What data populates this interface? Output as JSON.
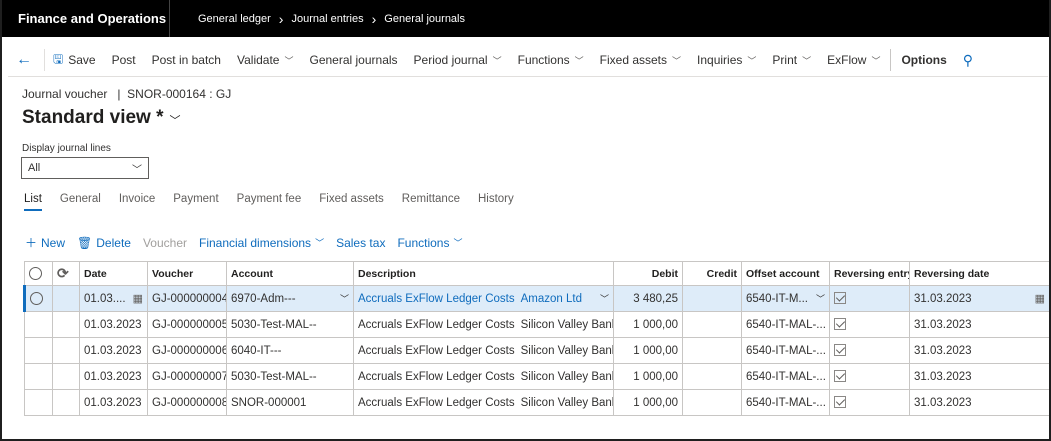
{
  "app_title": "Finance and Operations",
  "breadcrumbs": [
    "General ledger",
    "Journal entries",
    "General journals"
  ],
  "action_pane": {
    "save": "Save",
    "post": "Post",
    "post_in_batch": "Post in batch",
    "validate": "Validate",
    "general_journals": "General journals",
    "period_journal": "Period journal",
    "functions": "Functions",
    "fixed_assets": "Fixed assets",
    "inquiries": "Inquiries",
    "print": "Print",
    "exflow": "ExFlow",
    "options": "Options"
  },
  "header": {
    "caption": "Journal voucher   |  SNOR-000164 : GJ",
    "view_name": "Standard view *",
    "display_lines_label": "Display journal lines",
    "display_lines_value": "All"
  },
  "tabs": [
    "List",
    "General",
    "Invoice",
    "Payment",
    "Payment fee",
    "Fixed assets",
    "Remittance",
    "History"
  ],
  "grid_toolbar": {
    "new": "New",
    "delete": "Delete",
    "voucher": "Voucher",
    "financial_dimensions": "Financial dimensions",
    "sales_tax": "Sales tax",
    "functions": "Functions"
  },
  "columns": {
    "date": "Date",
    "voucher": "Voucher",
    "account": "Account",
    "description": "Description",
    "debit": "Debit",
    "credit": "Credit",
    "offset_account": "Offset account",
    "reversing_entry": "Reversing entry",
    "reversing_date": "Reversing date"
  },
  "rows": [
    {
      "date": "01.03....",
      "voucher": "GJ-000000004",
      "account": "6970-Adm---",
      "desc_a": "Accruals ExFlow Ledger Costs",
      "desc_b": "Amazon Ltd",
      "debit": "3 480,25",
      "credit": "",
      "offset": "6540-IT-M...",
      "reversing_date": "31.03.2023"
    },
    {
      "date": "01.03.2023",
      "voucher": "GJ-000000005",
      "account": "5030-Test-MAL--",
      "desc_a": "Accruals ExFlow Ledger Costs",
      "desc_b": "Silicon Valley Bank",
      "debit": "1 000,00",
      "credit": "",
      "offset": "6540-IT-MAL-...",
      "reversing_date": "31.03.2023"
    },
    {
      "date": "01.03.2023",
      "voucher": "GJ-000000006",
      "account": "6040-IT---",
      "desc_a": "Accruals ExFlow Ledger Costs",
      "desc_b": "Silicon Valley Bank",
      "debit": "1 000,00",
      "credit": "",
      "offset": "6540-IT-MAL-...",
      "reversing_date": "31.03.2023"
    },
    {
      "date": "01.03.2023",
      "voucher": "GJ-000000007",
      "account": "5030-Test-MAL--",
      "desc_a": "Accruals ExFlow Ledger Costs",
      "desc_b": "Silicon Valley Bank",
      "debit": "1 000,00",
      "credit": "",
      "offset": "6540-IT-MAL-...",
      "reversing_date": "31.03.2023"
    },
    {
      "date": "01.03.2023",
      "voucher": "GJ-000000008",
      "account": "SNOR-000001",
      "desc_a": "Accruals ExFlow Ledger Costs",
      "desc_b": "Silicon Valley Bank",
      "debit": "1 000,00",
      "credit": "",
      "offset": "6540-IT-MAL-...",
      "reversing_date": "31.03.2023"
    }
  ]
}
